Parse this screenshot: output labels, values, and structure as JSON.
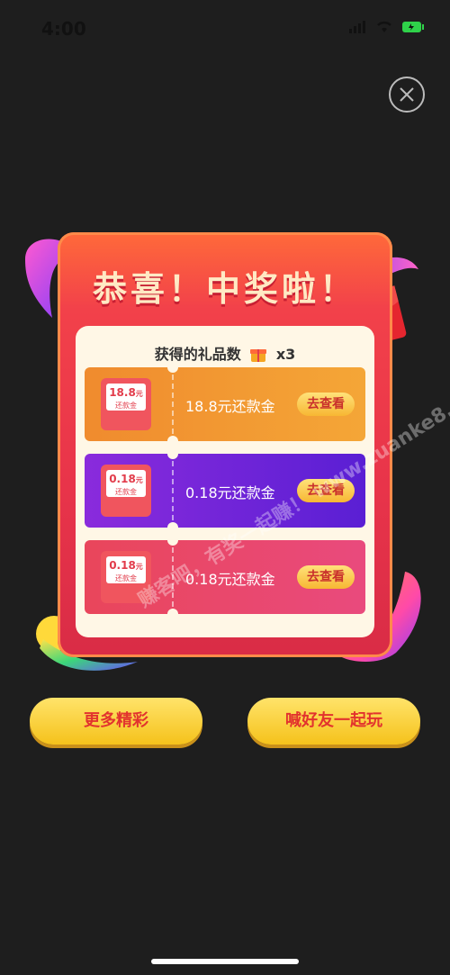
{
  "status_bar": {
    "time": "4:00"
  },
  "card": {
    "title": "恭喜！中奖啦！",
    "gift_count_label": "获得的礼品数",
    "gift_count_value": "x3"
  },
  "coupons": [
    {
      "ticket_amount": "18.8",
      "ticket_unit": "元",
      "ticket_label": "还款金",
      "text": "18.8元还款金",
      "button": "去查看",
      "style": "orange"
    },
    {
      "ticket_amount": "0.18",
      "ticket_unit": "元",
      "ticket_label": "还款金",
      "text": "0.18元还款金",
      "button": "去查看",
      "style": "purple"
    },
    {
      "ticket_amount": "0.18",
      "ticket_unit": "元",
      "ticket_label": "还款金",
      "text": "0.18元还款金",
      "button": "去查看",
      "style": "pink"
    }
  ],
  "actions": {
    "more": "更多精彩",
    "invite": "喊好友一起玩"
  },
  "watermark": "赚客吧，有奖一起赚！ www.zuanke8.com",
  "colors": {
    "background": "#1e1e1e",
    "card_red": "#e8344a",
    "button_yellow": "#f5c21b",
    "button_text": "#e2332e"
  }
}
